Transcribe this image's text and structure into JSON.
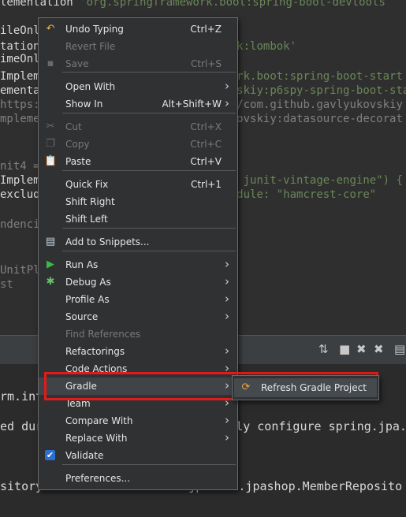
{
  "editor": {
    "lines": [
      {
        "a": "lementation ",
        "b": "'org.springframework.boot:spring-boot-devtools",
        "ca": "c-white",
        "cb": "c-str"
      },
      {
        "a": "ileOnl",
        "b": "",
        "ca": "c-white",
        "cb": "c-str"
      },
      {
        "a": "tation",
        "b": "k:lombok'",
        "ca": "c-white",
        "cb": "c-str"
      },
      {
        "a": "imeOnl",
        "b": "",
        "ca": "c-white",
        "cb": "c-str"
      },
      {
        "a": "Implem",
        "b": "rk.boot:spring-boot-start",
        "ca": "c-white",
        "cb": "c-str"
      },
      {
        "a": "ementa",
        "b": "skiy:p6spy-spring-boot-sta",
        "ca": "c-white",
        "cb": "c-str"
      },
      {
        "a": "https:/",
        "b": "/com.github.gavlyukovskiy",
        "ca": "c-gray",
        "cb": "c-gray"
      },
      {
        "a": "mpleme",
        "b": "ovskiy:datasource-decorat",
        "ca": "c-gray",
        "cb": "c-gray"
      },
      {
        "a": "nit4 =",
        "b": "",
        "ca": "c-gray",
        "cb": "c-gray"
      },
      {
        "a": "Implem",
        "b": " junit-vintage-engine\") {",
        "ca": "c-white",
        "cb": "c-str"
      },
      {
        "a": "exclud",
        "b": "dule: \"hamcrest-core\"",
        "ca": "c-white",
        "cb": "c-str"
      },
      {
        "a": "ndenci",
        "b": "",
        "ca": "c-gray",
        "cb": "c-gray"
      },
      {
        "a": "UnitPl",
        "b": "",
        "ca": "c-gray",
        "cb": "c-gray"
      },
      {
        "a": "st",
        "b": "",
        "ca": "c-gray",
        "cb": "c-gray"
      }
    ]
  },
  "console": {
    "lines": [
      {
        "a": "rm.int",
        "b": ""
      },
      {
        "a": "ed dur",
        "b": "ly configure spring.jpa."
      },
      {
        "a": "sitory",
        "b": "jpabook.jpashop.MemberReposito"
      }
    ]
  },
  "menu": {
    "items": [
      {
        "label": "Undo Typing",
        "accel": "Ctrl+Z",
        "icon": "undo-icon",
        "glyph": "↶",
        "disabled": false,
        "submenu": false
      },
      {
        "label": "Revert File",
        "accel": "",
        "icon": "",
        "glyph": "",
        "disabled": true,
        "submenu": false
      },
      {
        "label": "Save",
        "accel": "Ctrl+S",
        "icon": "save-icon",
        "glyph": "▪",
        "disabled": true,
        "submenu": false
      },
      {
        "label": "Open With",
        "accel": "",
        "icon": "",
        "glyph": "",
        "disabled": false,
        "submenu": true
      },
      {
        "label": "Show In",
        "accel": "Alt+Shift+W",
        "icon": "",
        "glyph": "",
        "disabled": false,
        "submenu": true
      },
      {
        "label": "Cut",
        "accel": "Ctrl+X",
        "icon": "scissors-icon",
        "glyph": "✂",
        "disabled": true,
        "submenu": false
      },
      {
        "label": "Copy",
        "accel": "Ctrl+C",
        "icon": "copy-icon",
        "glyph": "❐",
        "disabled": true,
        "submenu": false
      },
      {
        "label": "Paste",
        "accel": "Ctrl+V",
        "icon": "paste-icon",
        "glyph": "📋",
        "disabled": false,
        "submenu": false
      },
      {
        "label": "Quick Fix",
        "accel": "Ctrl+1",
        "icon": "",
        "glyph": "",
        "disabled": false,
        "submenu": false
      },
      {
        "label": "Shift Right",
        "accel": "",
        "icon": "",
        "glyph": "",
        "disabled": false,
        "submenu": false
      },
      {
        "label": "Shift Left",
        "accel": "",
        "icon": "",
        "glyph": "",
        "disabled": false,
        "submenu": false
      },
      {
        "label": "Add to Snippets...",
        "accel": "",
        "icon": "snippet-icon",
        "glyph": "▤",
        "disabled": false,
        "submenu": false
      },
      {
        "label": "Run As",
        "accel": "",
        "icon": "run-icon",
        "glyph": "▶",
        "disabled": false,
        "submenu": true
      },
      {
        "label": "Debug As",
        "accel": "",
        "icon": "debug-icon",
        "glyph": "✱",
        "disabled": false,
        "submenu": true
      },
      {
        "label": "Profile As",
        "accel": "",
        "icon": "",
        "glyph": "",
        "disabled": false,
        "submenu": true
      },
      {
        "label": "Source",
        "accel": "",
        "icon": "",
        "glyph": "",
        "disabled": false,
        "submenu": true
      },
      {
        "label": "Find References",
        "accel": "",
        "icon": "",
        "glyph": "",
        "disabled": true,
        "submenu": false
      },
      {
        "label": "Refactorings",
        "accel": "",
        "icon": "",
        "glyph": "",
        "disabled": false,
        "submenu": true
      },
      {
        "label": "Code Actions",
        "accel": "",
        "icon": "",
        "glyph": "",
        "disabled": false,
        "submenu": true
      },
      {
        "label": "Gradle",
        "accel": "",
        "icon": "",
        "glyph": "",
        "disabled": false,
        "submenu": true,
        "highlighted": true
      },
      {
        "label": "Team",
        "accel": "",
        "icon": "",
        "glyph": "",
        "disabled": false,
        "submenu": true
      },
      {
        "label": "Compare With",
        "accel": "",
        "icon": "",
        "glyph": "",
        "disabled": false,
        "submenu": true
      },
      {
        "label": "Replace With",
        "accel": "",
        "icon": "",
        "glyph": "",
        "disabled": false,
        "submenu": true
      },
      {
        "label": "Validate",
        "accel": "",
        "icon": "checkbox-icon",
        "glyph": "✔",
        "disabled": false,
        "submenu": false
      },
      {
        "label": "Preferences...",
        "accel": "",
        "icon": "",
        "glyph": "",
        "disabled": false,
        "submenu": false
      }
    ]
  },
  "submenu": {
    "label": "Refresh Gradle Project",
    "icon": "refresh-gradle-icon"
  },
  "colors": {
    "highlight_box": "#e01b1b",
    "string": "#6a8759"
  }
}
